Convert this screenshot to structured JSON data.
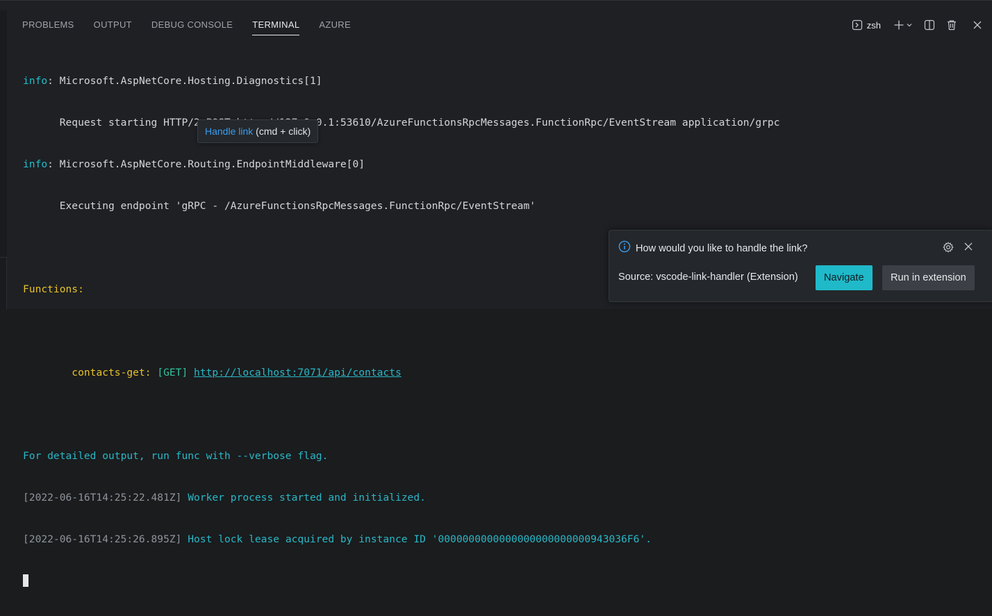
{
  "tabs": [
    {
      "label": "PROBLEMS"
    },
    {
      "label": "OUTPUT"
    },
    {
      "label": "DEBUG CONSOLE"
    },
    {
      "label": "TERMINAL",
      "active": true
    },
    {
      "label": "AZURE"
    }
  ],
  "actions": {
    "shell_label": "zsh",
    "icons": [
      "terminal-icon",
      "add-icon",
      "chevron-down-icon",
      "split-icon",
      "trash-icon",
      "close-icon"
    ]
  },
  "terminal": {
    "line1_prefix": "info",
    "line1_rest": ": Microsoft.AspNetCore.Hosting.Diagnostics[1]",
    "line2": "      Request starting HTTP/2 POST http://127.0.0.1:53610/AzureFunctionsRpcMessages.FunctionRpc/EventStream application/grpc",
    "line3_prefix": "info",
    "line3_rest": ": Microsoft.AspNetCore.Routing.EndpointMiddleware[0]",
    "line4": "      Executing endpoint 'gRPC - /AzureFunctionsRpcMessages.FunctionRpc/EventStream'",
    "functions_header": "Functions:",
    "function_indent": "        ",
    "function_name": "contacts-get:",
    "function_method": " [GET] ",
    "function_url": "http://localhost:7071/api/contacts",
    "verbose_hint": "For detailed output, run func with --verbose flag.",
    "log1_time": "[2022-06-16T14:25:22.481Z]",
    "log1_msg": " Worker process started and initialized.",
    "log2_time": "[2022-06-16T14:25:26.895Z]",
    "log2_msg": " Host lock lease acquired by instance ID '0000000000000000000000000943036F6'."
  },
  "hover": {
    "link_label": "Handle link",
    "shortcut": " (cmd + click)"
  },
  "toast": {
    "message": "How would you like to handle the link?",
    "source": "Source: vscode-link-handler (Extension)",
    "primary_button": "Navigate",
    "secondary_button": "Run in extension"
  },
  "colors": {
    "accent": "#1fb9c9",
    "info": "#21bdca",
    "yellow": "#e8c22a",
    "link_blue": "#3b9cf0"
  }
}
